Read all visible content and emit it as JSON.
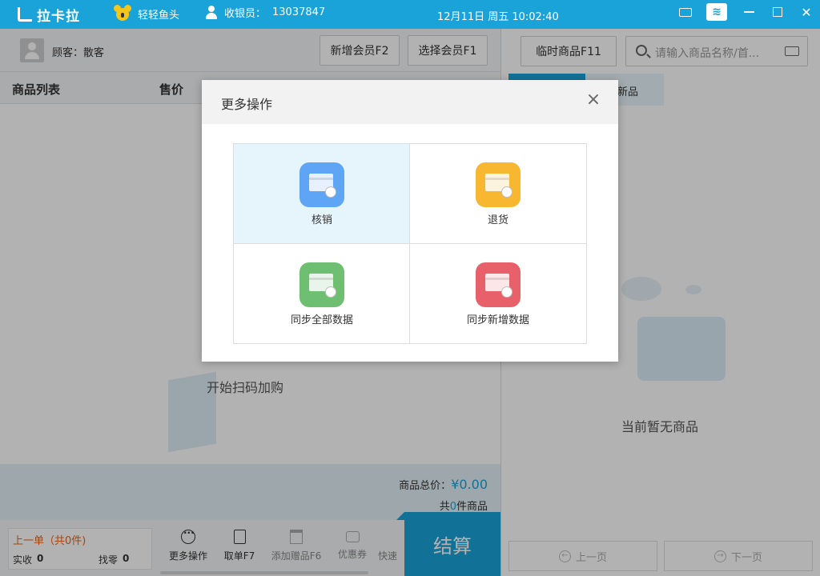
{
  "titlebar": {
    "app_name": "拉卡拉",
    "shop_name": "轻轻鱼头",
    "cashier_label": "收银员：",
    "cashier_id": "13037847",
    "datetime": "12月11日 周五 10:02:40"
  },
  "customer": {
    "label": "顾客：散客",
    "add_member": "新增会员F2",
    "select_member": "选择会员F1"
  },
  "list_header": {
    "col_product": "商品列表",
    "col_price": "售价"
  },
  "empty_state": {
    "left": "开始扫码加购",
    "right": "当前暂无商品"
  },
  "summary": {
    "total_label": "商品总价：",
    "total_value": "¥0.00",
    "count_prefix": "共",
    "count_value": "0",
    "count_suffix": "件商品"
  },
  "last_order": {
    "title": "上一单（共0件)",
    "paid_label": "实收",
    "paid_value": "0",
    "change_label": "找零",
    "change_value": "0"
  },
  "toolbar": {
    "more": "更多操作",
    "take_order": "取单F7",
    "add_gift": "添加赠品F6",
    "coupon": "优惠券",
    "quick": "快速"
  },
  "checkout": "结算",
  "right_panel": {
    "temp_product": "临时商品F11",
    "search_placeholder": "请输入商品名称/首...",
    "tab_inactive": "新品",
    "prev_page": "上一页",
    "next_page": "下一页"
  },
  "modal": {
    "title": "更多操作",
    "ops": [
      {
        "label": "核销",
        "color": "#5ea6f5"
      },
      {
        "label": "退货",
        "color": "#f7b731"
      },
      {
        "label": "同步全部数据",
        "color": "#6fbf73"
      },
      {
        "label": "同步新增数据",
        "color": "#e8616a"
      }
    ]
  },
  "colors": {
    "accent": "#1aa3d9",
    "warning": "#e8631a"
  }
}
